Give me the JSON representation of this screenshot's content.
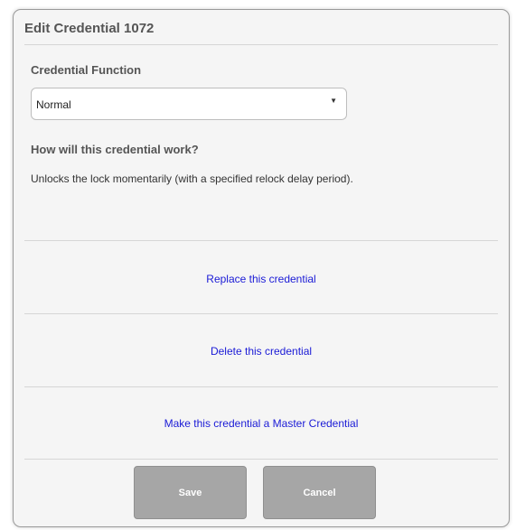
{
  "dialog": {
    "title": "Edit Credential 1072"
  },
  "function_section": {
    "label": "Credential Function",
    "selected_value": "Normal",
    "dropdown_arrow_glyph": "▼"
  },
  "help_section": {
    "heading": "How will this credential work?",
    "description": "Unlocks the lock momentarily (with a specified relock delay period)."
  },
  "actions": {
    "replace_label": "Replace this credential",
    "delete_label": "Delete this credential",
    "master_label": "Make this credential a Master Credential"
  },
  "footer": {
    "save_label": "Save",
    "cancel_label": "Cancel"
  },
  "colors": {
    "link": "#1a1ad6",
    "button_bg": "#a6a6a6",
    "dialog_bg": "#f5f5f5",
    "heading_text": "#555555"
  },
  "icons": {
    "dropdown": "chevron-down-icon"
  }
}
